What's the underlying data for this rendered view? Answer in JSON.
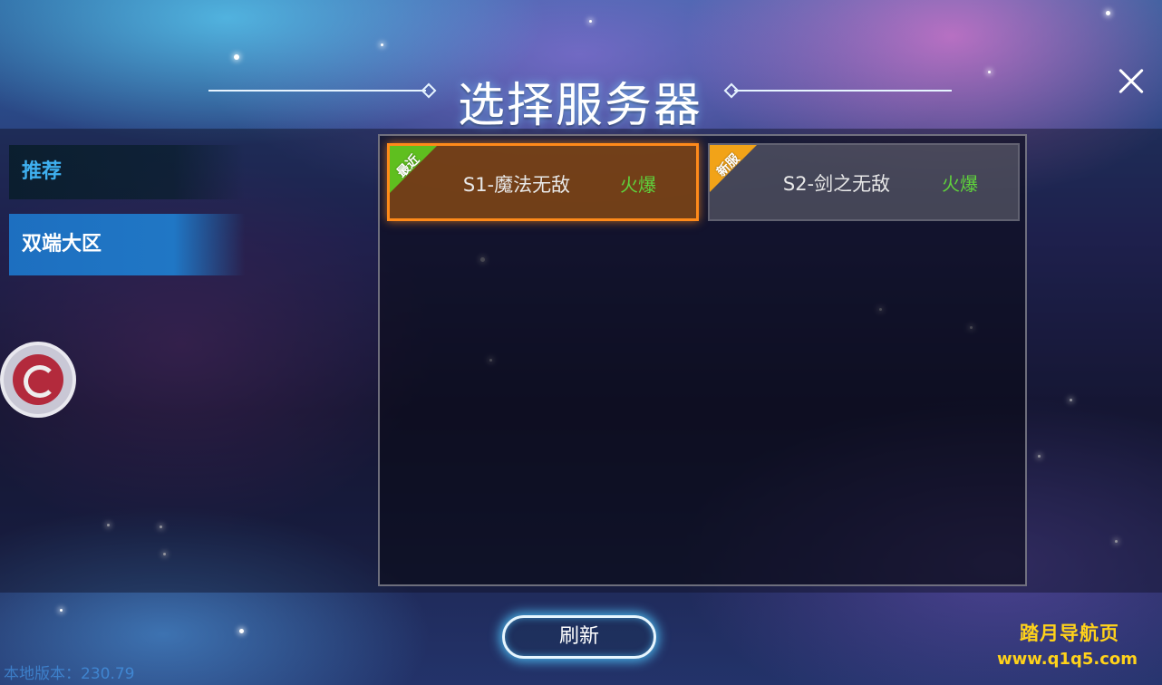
{
  "header": {
    "title": "选择服务器",
    "close_icon": "close-icon"
  },
  "sidebar": {
    "tabs": [
      {
        "label": "推荐",
        "selected": false
      },
      {
        "label": "双端大区",
        "selected": true
      }
    ],
    "logo_icon": "game-logo-icon"
  },
  "servers": [
    {
      "tag": "最近",
      "tag_color": "#5fbf1f",
      "name": "S1-魔法无敌",
      "status": "火爆",
      "selected": true
    },
    {
      "tag": "新服",
      "tag_color": "#f2a318",
      "name": "S2-剑之无敌",
      "status": "火爆",
      "selected": false
    }
  ],
  "footer": {
    "refresh_label": "刷新",
    "version_text": "本地版本：230.79"
  },
  "watermark": {
    "line1": "踏月导航页",
    "line2": "www.q1q5.com"
  },
  "colors": {
    "accent": "#3fb0f0",
    "selected_border": "#ff8a1a",
    "status_hot": "#5fd23c",
    "watermark": "#ffd21a"
  }
}
